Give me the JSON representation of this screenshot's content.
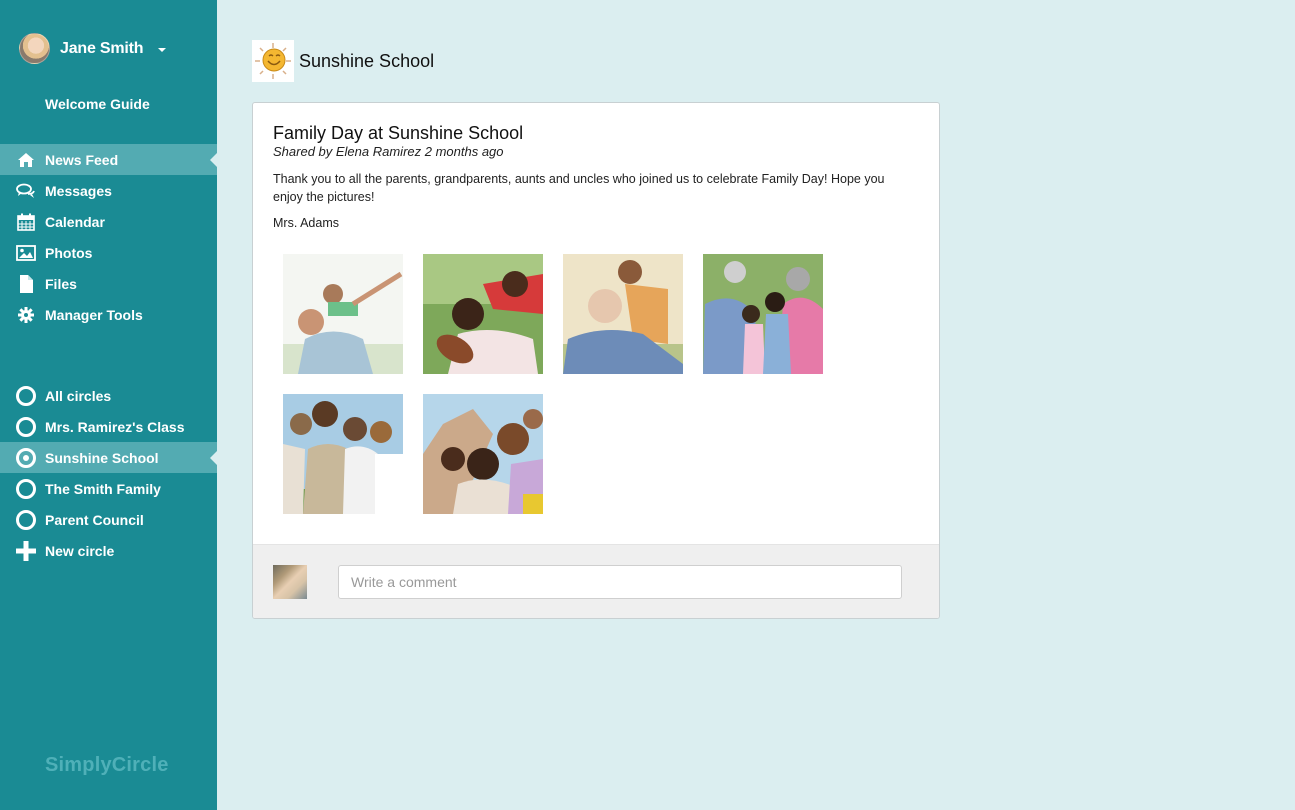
{
  "user": {
    "name": "Jane Smith",
    "avatar_icon": "user-avatar"
  },
  "welcome_guide": "Welcome Guide",
  "nav": {
    "items": [
      {
        "label": "News Feed",
        "icon": "home-icon",
        "active": true
      },
      {
        "label": "Messages",
        "icon": "chat-bubbles-icon",
        "active": false
      },
      {
        "label": "Calendar",
        "icon": "calendar-icon",
        "active": false
      },
      {
        "label": "Photos",
        "icon": "image-icon",
        "active": false
      },
      {
        "label": "Files",
        "icon": "file-icon",
        "active": false
      },
      {
        "label": "Manager Tools",
        "icon": "gear-icon",
        "active": false
      }
    ]
  },
  "circles": {
    "items": [
      {
        "label": "All circles",
        "selected": false
      },
      {
        "label": "Mrs. Ramirez's Class",
        "selected": false
      },
      {
        "label": "Sunshine School",
        "selected": true
      },
      {
        "label": "The Smith Family",
        "selected": false
      },
      {
        "label": "Parent Council",
        "selected": false
      }
    ],
    "new_circle": "New circle"
  },
  "brand": "SimplyCircle",
  "group": {
    "title": "Sunshine School",
    "logo_icon": "sun-icon"
  },
  "post": {
    "title": "Family Day at Sunshine School",
    "meta": "Shared by Elena Ramirez 2 months ago",
    "body": "Thank you to all the parents, grandparents, aunts and uncles who joined us to celebrate Family Day! Hope you enjoy the pictures!",
    "signature": "Mrs. Adams",
    "photos": [
      {
        "alt": "Father carrying son piggyback"
      },
      {
        "alt": "Father and son with football"
      },
      {
        "alt": "Grandfather with grandson"
      },
      {
        "alt": "Grandparents with grandchildren"
      },
      {
        "alt": "Family of four outdoors"
      },
      {
        "alt": "Family smiling together"
      }
    ]
  },
  "comment": {
    "placeholder": "Write a comment",
    "value": ""
  },
  "colors": {
    "sidebar": "#1a8b94",
    "sidebar_active": "#53abb2",
    "page_bg": "#dbeef0"
  }
}
